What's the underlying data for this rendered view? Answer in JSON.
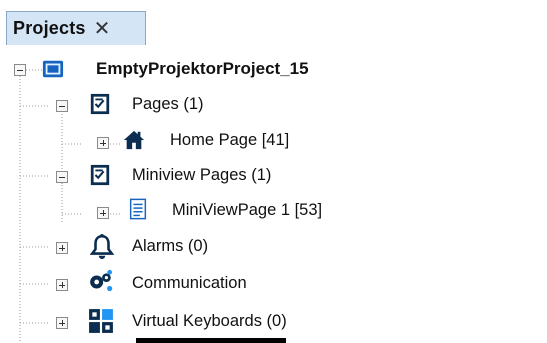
{
  "panel": {
    "title": "Projects",
    "close_glyph": "✕"
  },
  "tree": {
    "root": {
      "label": "EmptyProjektorProject_15",
      "icon": "project-icon",
      "expanded": true
    },
    "items": [
      {
        "label": "Pages (1)",
        "icon": "pages-icon",
        "expanded": true,
        "level": 1
      },
      {
        "label": "Home Page [41]",
        "icon": "home-icon",
        "expanded": false,
        "level": 2
      },
      {
        "label": "Miniview Pages (1)",
        "icon": "pages-icon",
        "expanded": true,
        "level": 1
      },
      {
        "label": "MiniViewPage 1 [53]",
        "icon": "document-icon",
        "expanded": false,
        "level": 2
      },
      {
        "label": "Alarms (0)",
        "icon": "alarm-bell-icon",
        "expanded": false,
        "level": 1
      },
      {
        "label": "Communication",
        "icon": "communication-icon",
        "expanded": false,
        "level": 1
      },
      {
        "label": "Virtual Keyboards (0)",
        "icon": "keyboard-icon",
        "expanded": false,
        "level": 1
      }
    ]
  },
  "colors": {
    "tab_bg": "#d4e5f6",
    "tab_border": "#8aa7c7",
    "icon_blue": "#1565c0",
    "dark_icon": "#0b2d4f"
  }
}
